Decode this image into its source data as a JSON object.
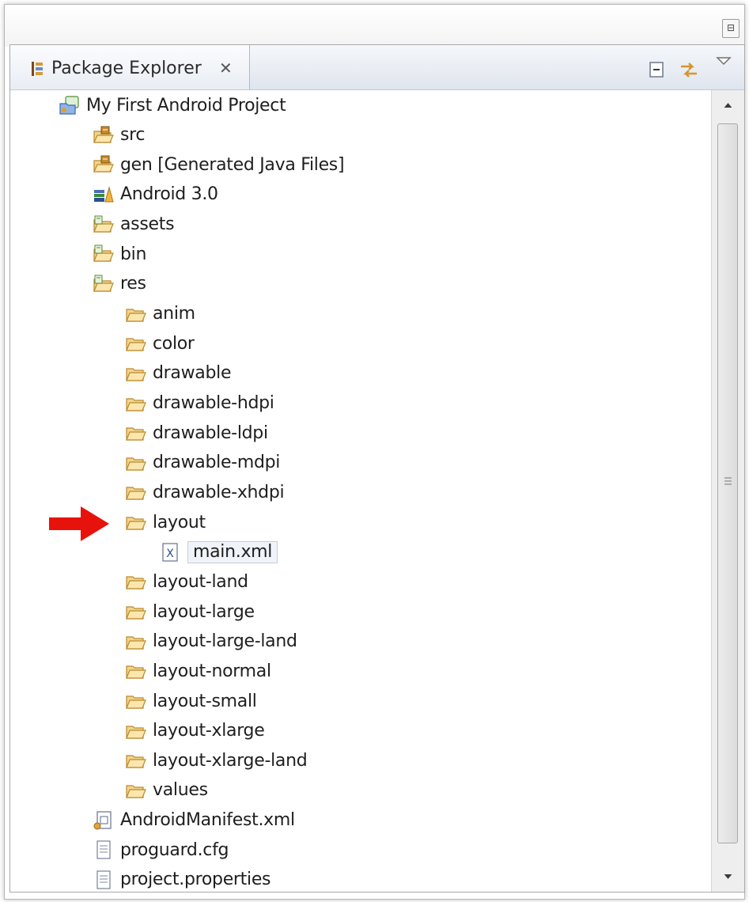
{
  "window": {
    "restore_icon": "restore-icon"
  },
  "view": {
    "tab_title": "Package Explorer",
    "tab_icon": "package-explorer-icon",
    "close_icon": "close-tab-icon",
    "toolbar": {
      "collapse_icon": "collapse-all-icon",
      "link_icon": "link-with-editor-icon",
      "menu_icon": "view-menu-chevron-icon"
    }
  },
  "tree": {
    "items": [
      {
        "label": "My First Android Project",
        "icon": "android-project-icon",
        "depth": 0
      },
      {
        "label": "src",
        "icon": "source-folder-icon",
        "depth": 1
      },
      {
        "label": "gen [Generated Java Files]",
        "icon": "source-folder-icon",
        "depth": 1
      },
      {
        "label": "Android 3.0",
        "icon": "android-library-icon",
        "depth": 1
      },
      {
        "label": "assets",
        "icon": "project-folder-icon",
        "depth": 1
      },
      {
        "label": "bin",
        "icon": "project-folder-icon",
        "depth": 1
      },
      {
        "label": "res",
        "icon": "project-folder-icon",
        "depth": 1
      },
      {
        "label": "anim",
        "icon": "folder-icon",
        "depth": 2
      },
      {
        "label": "color",
        "icon": "folder-icon",
        "depth": 2
      },
      {
        "label": "drawable",
        "icon": "folder-icon",
        "depth": 2
      },
      {
        "label": "drawable-hdpi",
        "icon": "folder-icon",
        "depth": 2
      },
      {
        "label": "drawable-ldpi",
        "icon": "folder-icon",
        "depth": 2
      },
      {
        "label": "drawable-mdpi",
        "icon": "folder-icon",
        "depth": 2
      },
      {
        "label": "drawable-xhdpi",
        "icon": "folder-icon",
        "depth": 2
      },
      {
        "label": "layout",
        "icon": "folder-icon",
        "depth": 2
      },
      {
        "label": "main.xml",
        "icon": "xml-file-icon",
        "depth": 3
      },
      {
        "label": "layout-land",
        "icon": "folder-icon",
        "depth": 2
      },
      {
        "label": "layout-large",
        "icon": "folder-icon",
        "depth": 2
      },
      {
        "label": "layout-large-land",
        "icon": "folder-icon",
        "depth": 2
      },
      {
        "label": "layout-normal",
        "icon": "folder-icon",
        "depth": 2
      },
      {
        "label": "layout-small",
        "icon": "folder-icon",
        "depth": 2
      },
      {
        "label": "layout-xlarge",
        "icon": "folder-icon",
        "depth": 2
      },
      {
        "label": "layout-xlarge-land",
        "icon": "folder-icon",
        "depth": 2
      },
      {
        "label": "values",
        "icon": "folder-icon",
        "depth": 2
      },
      {
        "label": "AndroidManifest.xml",
        "icon": "android-manifest-icon",
        "depth": 1
      },
      {
        "label": "proguard.cfg",
        "icon": "text-file-icon",
        "depth": 1
      },
      {
        "label": "project.properties",
        "icon": "text-file-icon",
        "depth": 1
      }
    ],
    "selected_label": "main.xml"
  },
  "annotation": {
    "arrow_icon": "red-arrow-icon",
    "color": "#e8120c"
  }
}
